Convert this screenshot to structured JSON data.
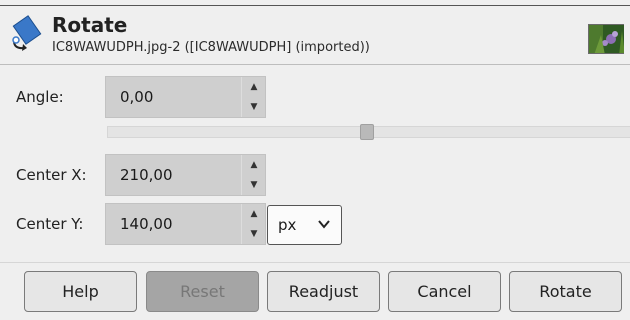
{
  "dialog": {
    "title": "Rotate",
    "subtitle": "IC8WAWUDPH.jpg-2 ([IC8WAWUDPH] (imported))",
    "icon": "rotate-tool-icon"
  },
  "angle": {
    "label": "Angle:",
    "value": "0,00",
    "slider_fraction": 0.5
  },
  "center_x": {
    "label": "Center X:",
    "value": "210,00"
  },
  "center_y": {
    "label": "Center Y:",
    "value": "140,00"
  },
  "unit": {
    "selected": "px"
  },
  "buttons": {
    "help": "Help",
    "reset": "Reset",
    "readjust": "Readjust",
    "cancel": "Cancel",
    "rotate": "Rotate"
  },
  "colors": {
    "background": "#efefef",
    "spin_bg": "#cfcfcf",
    "disabled_button": "#a5a5a5",
    "icon_blue": "#3a78c8"
  }
}
